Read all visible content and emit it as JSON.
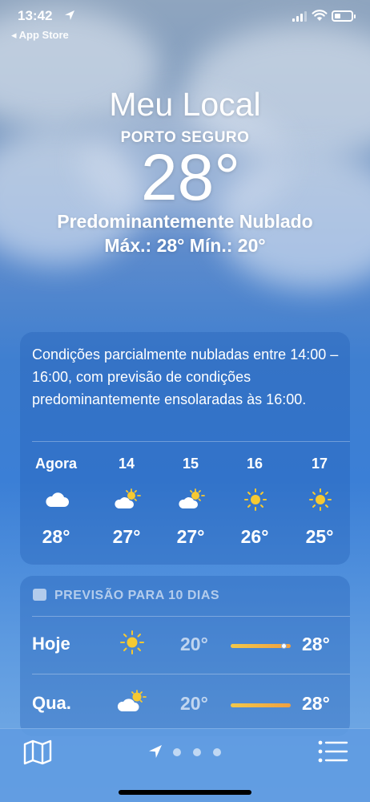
{
  "status_bar": {
    "time": "13:42",
    "back_label": "◂ App Store"
  },
  "hero": {
    "title": "Meu Local",
    "city": "PORTO SEGURO",
    "temperature": "28°",
    "condition": "Predominantemente Nublado",
    "minmax": "Máx.: 28°  Mín.: 20°"
  },
  "hourly": {
    "summary": "Condições parcialmente nubladas entre 14:00 – 16:00, com previsão de condições predominantemente ensolaradas às 16:00.",
    "hours": [
      {
        "label": "Agora",
        "icon": "cloud-icon",
        "temp": "28°"
      },
      {
        "label": "14",
        "icon": "partly-sunny-icon",
        "temp": "27°"
      },
      {
        "label": "15",
        "icon": "partly-sunny-icon",
        "temp": "27°"
      },
      {
        "label": "16",
        "icon": "sun-icon",
        "temp": "26°"
      },
      {
        "label": "17",
        "icon": "sun-icon",
        "temp": "25°"
      }
    ]
  },
  "daily": {
    "header": "PREVISÃO PARA 10 DIAS",
    "days": [
      {
        "name": "Hoje",
        "icon": "sun-icon",
        "low": "20°",
        "high": "28°",
        "current_marker": true
      },
      {
        "name": "Qua.",
        "icon": "partly-sunny-icon",
        "low": "20°",
        "high": "28°",
        "current_marker": false
      }
    ]
  },
  "colors": {
    "temp_bar_start": "#f2c84a",
    "temp_bar_end": "#f0a040",
    "sun": "#f6c931"
  }
}
